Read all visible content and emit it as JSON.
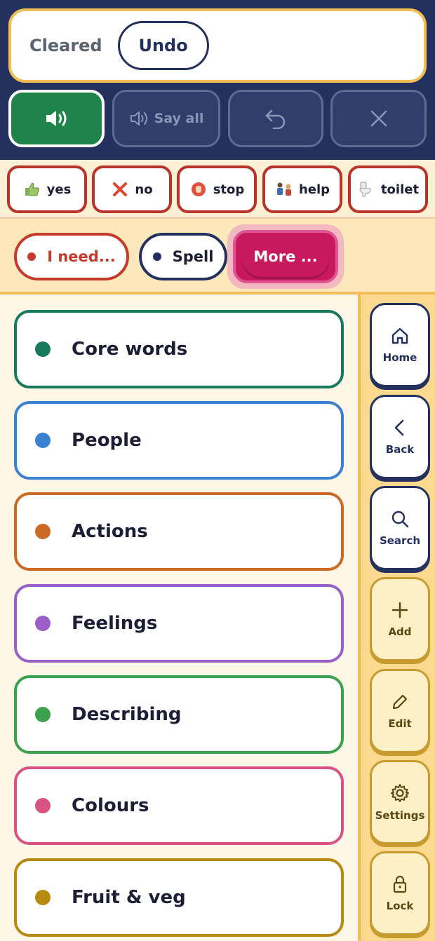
{
  "message_bar": {
    "status_text": "Cleared",
    "undo_label": "Undo"
  },
  "controls": {
    "say_all_label": "Say all"
  },
  "quick_phrases": [
    {
      "label": "yes",
      "icon": "thumbs-up-icon"
    },
    {
      "label": "no",
      "icon": "cross-icon"
    },
    {
      "label": "stop",
      "icon": "stop-hand-icon"
    },
    {
      "label": "help",
      "icon": "help-person-icon"
    },
    {
      "label": "toilet",
      "icon": "toilet-icon"
    }
  ],
  "category_bar": {
    "need_label": "I need...",
    "spell_label": "Spell",
    "more_label": "More ..."
  },
  "categories": [
    {
      "label": "Core words",
      "color": "#177a5c"
    },
    {
      "label": "People",
      "color": "#3a82d0"
    },
    {
      "label": "Actions",
      "color": "#cc6a24"
    },
    {
      "label": "Feelings",
      "color": "#9a5fc8"
    },
    {
      "label": "Describing",
      "color": "#3ca14e"
    },
    {
      "label": "Colours",
      "color": "#d85382"
    },
    {
      "label": "Fruit & veg",
      "color": "#b98a11"
    }
  ],
  "side_nav": [
    {
      "label": "Home",
      "icon": "home-icon"
    },
    {
      "label": "Back",
      "icon": "chevron-left-icon"
    },
    {
      "label": "Search",
      "icon": "search-icon"
    },
    {
      "label": "Add",
      "icon": "plus-icon"
    },
    {
      "label": "Edit",
      "icon": "pencil-icon"
    },
    {
      "label": "Settings",
      "icon": "gear-icon"
    },
    {
      "label": "Lock",
      "icon": "lock-icon"
    }
  ]
}
